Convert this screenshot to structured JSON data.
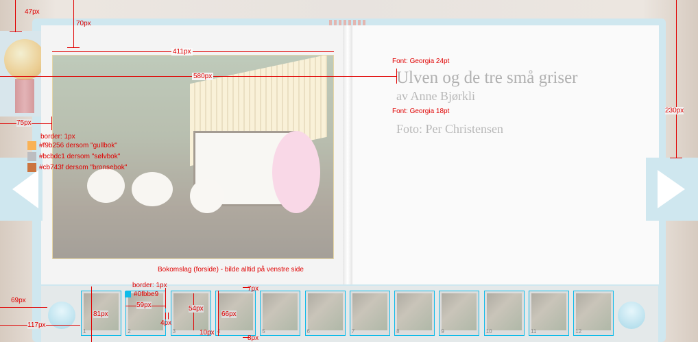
{
  "book": {
    "title": "Ulven og de tre små griser",
    "author": "av Anne Bjørkli",
    "photo_credit": "Foto: Per Christensen"
  },
  "annotations": {
    "top_47": "47px",
    "top_70": "70px",
    "w_411": "411px",
    "w_580": "580px",
    "h_230": "230px",
    "w_75": "75px",
    "font_title": "Font: Georgia 24pt",
    "font_sub": "Font: Georgia 18pt",
    "border_1": "border: 1px",
    "gull": "#f9b256 dersom \"gullbok\"",
    "solv": "#bcbdc1 dersom \"sølvbok\"",
    "bronse": "#cb743f dersom \"bronsebok\"",
    "cover_caption": "Bokomslag (forside) - bilde alltid på venstre side",
    "border_2": "border: 1px",
    "color_thumb": "#0fbbe9",
    "w_59": "59px",
    "h_54": "54px",
    "w_4": "4px",
    "h_81": "81px",
    "h_66": "66px",
    "w_10": "10px",
    "h_7": "7px",
    "h_8": "8px",
    "w_69": "69px",
    "w_117": "117px"
  },
  "colors": {
    "gull": "#f9b256",
    "solv": "#bcbdc1",
    "bronse": "#cb743f",
    "thumb_border": "#0fbbe9"
  },
  "thumbnails": [
    "1",
    "2",
    "3",
    "4",
    "5",
    "6",
    "7",
    "8",
    "9",
    "10",
    "11",
    "12"
  ]
}
